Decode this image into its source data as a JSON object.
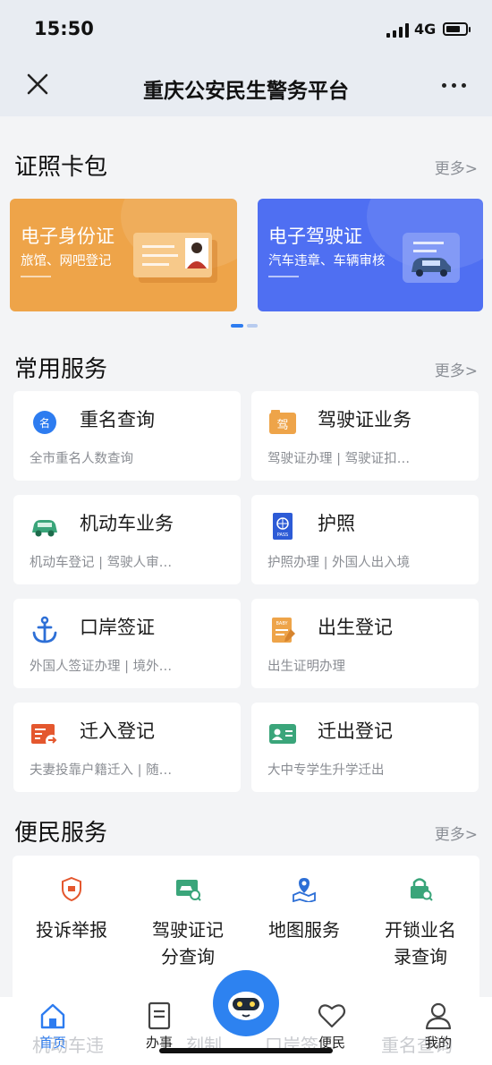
{
  "status": {
    "time": "15:50",
    "network": "4G"
  },
  "nav": {
    "title": "重庆公安民生警务平台"
  },
  "wallet": {
    "title": "证照卡包",
    "more": "更多>",
    "cards": [
      {
        "title": "电子身份证",
        "subtitle": "旅馆、网吧登记",
        "color": "#eea449"
      },
      {
        "title": "电子驾驶证",
        "subtitle": "汽车违章、车辆审核",
        "color": "#4f6ff2"
      }
    ]
  },
  "services": {
    "title": "常用服务",
    "more": "更多>",
    "items": [
      {
        "name": "重名查询",
        "desc": "全市重名人数查询",
        "icon": "name-search-icon"
      },
      {
        "name": "驾驶证业务",
        "desc": "驾驶证办理 | 驾驶证扣…",
        "icon": "driver-license-icon"
      },
      {
        "name": "机动车业务",
        "desc": "机动车登记 | 驾驶人审…",
        "icon": "car-icon"
      },
      {
        "name": "护照",
        "desc": "护照办理 | 外国人出入境",
        "icon": "passport-icon"
      },
      {
        "name": "口岸签证",
        "desc": "外国人签证办理 | 境外…",
        "icon": "anchor-icon"
      },
      {
        "name": "出生登记",
        "desc": "出生证明办理",
        "icon": "birth-record-icon"
      },
      {
        "name": "迁入登记",
        "desc": "夫妻投靠户籍迁入 | 随…",
        "icon": "move-in-icon"
      },
      {
        "name": "迁出登记",
        "desc": "大中专学生升学迁出",
        "icon": "move-out-icon"
      }
    ]
  },
  "convenience": {
    "title": "便民服务",
    "more": "更多>",
    "items": [
      {
        "name": "投诉举报",
        "icon": "complaint-icon"
      },
      {
        "name": "驾驶证记分查询",
        "icon": "license-points-icon"
      },
      {
        "name": "地图服务",
        "icon": "map-icon"
      },
      {
        "name": "开锁业名录查询",
        "icon": "lock-search-icon"
      }
    ],
    "partial": [
      "机动车违",
      "刻制",
      "口岸签",
      "重名查询"
    ]
  },
  "tabs": [
    {
      "label": "首页",
      "icon": "home-icon",
      "color": "#2d7cf0"
    },
    {
      "label": "办事",
      "icon": "document-icon"
    },
    {
      "label": "便民",
      "icon": "heart-icon"
    },
    {
      "label": "我的",
      "icon": "user-icon"
    }
  ],
  "colors": {
    "accent": "#2d7cf0",
    "orange": "#eea449",
    "blue": "#4f6ff2",
    "green": "#3aa57a",
    "red": "#e4572e"
  }
}
